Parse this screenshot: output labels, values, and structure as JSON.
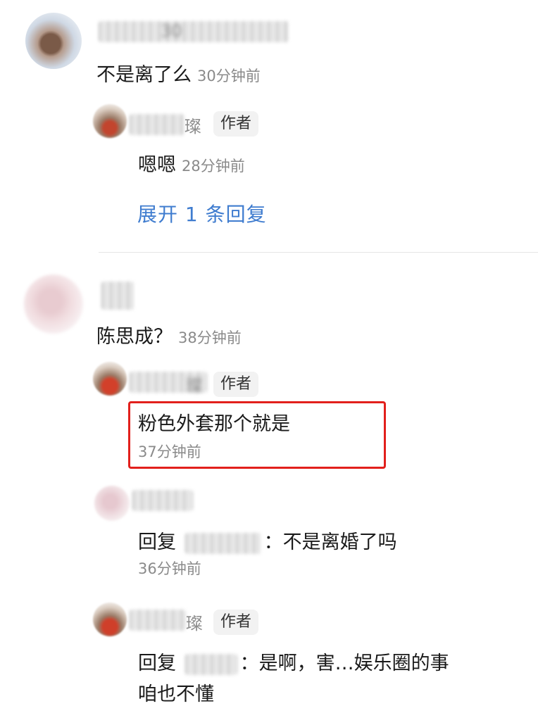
{
  "author_badge": "作者",
  "comments": [
    {
      "name_fragment": "30",
      "text": "不是离了么",
      "time": "30分钟前",
      "replies": [
        {
          "name_fragment": "璨",
          "text": "嗯嗯",
          "time": "28分钟前"
        }
      ],
      "expand_label": "展开 1 条回复"
    },
    {
      "text": "陈思成？",
      "time": "38分钟前",
      "replies": [
        {
          "name_fragment": "璨",
          "text": "粉色外套那个就是",
          "time": "37分钟前"
        },
        {
          "reply_prefix": "回复",
          "text": "：不是离婚了吗",
          "time": "36分钟前"
        },
        {
          "name_fragment": "璨",
          "reply_prefix": "回复",
          "text_line1": "：是啊，害…娱乐圈的事",
          "text_line2": "咱也不懂"
        }
      ]
    }
  ],
  "colors": {
    "expand_link": "#3f7ccf",
    "highlight_border": "#e2201c",
    "timestamp": "#8a8a8a"
  }
}
